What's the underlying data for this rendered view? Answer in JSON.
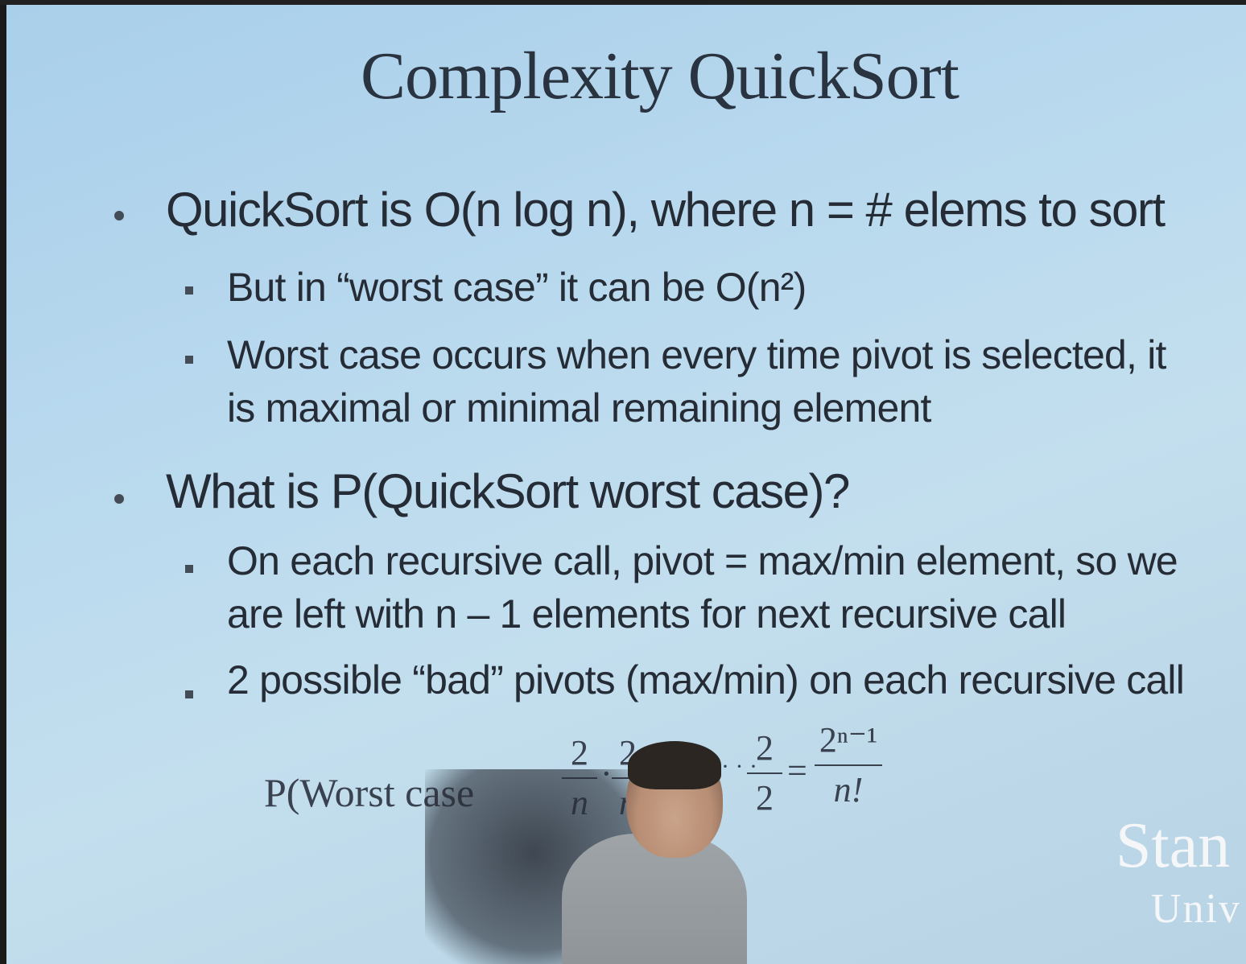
{
  "slide": {
    "title": "Complexity QuickSort",
    "bullets": [
      {
        "text": "QuickSort is O(n log n), where n = # elems to sort",
        "sub": [
          {
            "lines": [
              "But in “worst case” it can be O(n²)"
            ]
          },
          {
            "lines": [
              "Worst case occurs when every time pivot is selected, it",
              "is maximal or minimal remaining element"
            ]
          }
        ]
      },
      {
        "text": "What is P(QuickSort worst case)?",
        "sub": [
          {
            "lines": [
              "On each recursive call, pivot = max/min element, so we",
              "are left with n – 1 elements for next recursive call"
            ]
          },
          {
            "lines": [
              "2 possible “bad” pivots (max/min) on each recursive call"
            ]
          }
        ]
      }
    ],
    "formula": {
      "lhs": "P(Worst case",
      "frac1_num": "2",
      "frac1_den": "n",
      "frac2_num": "2",
      "frac2_den": "n",
      "frac3_num": "2",
      "frac3_den": "2",
      "ellipsis": "·",
      "equals": "=",
      "result_num": "2ⁿ⁻¹",
      "result_den": "n!"
    },
    "logo": {
      "line1": "Stan",
      "line2": "Univ"
    }
  }
}
